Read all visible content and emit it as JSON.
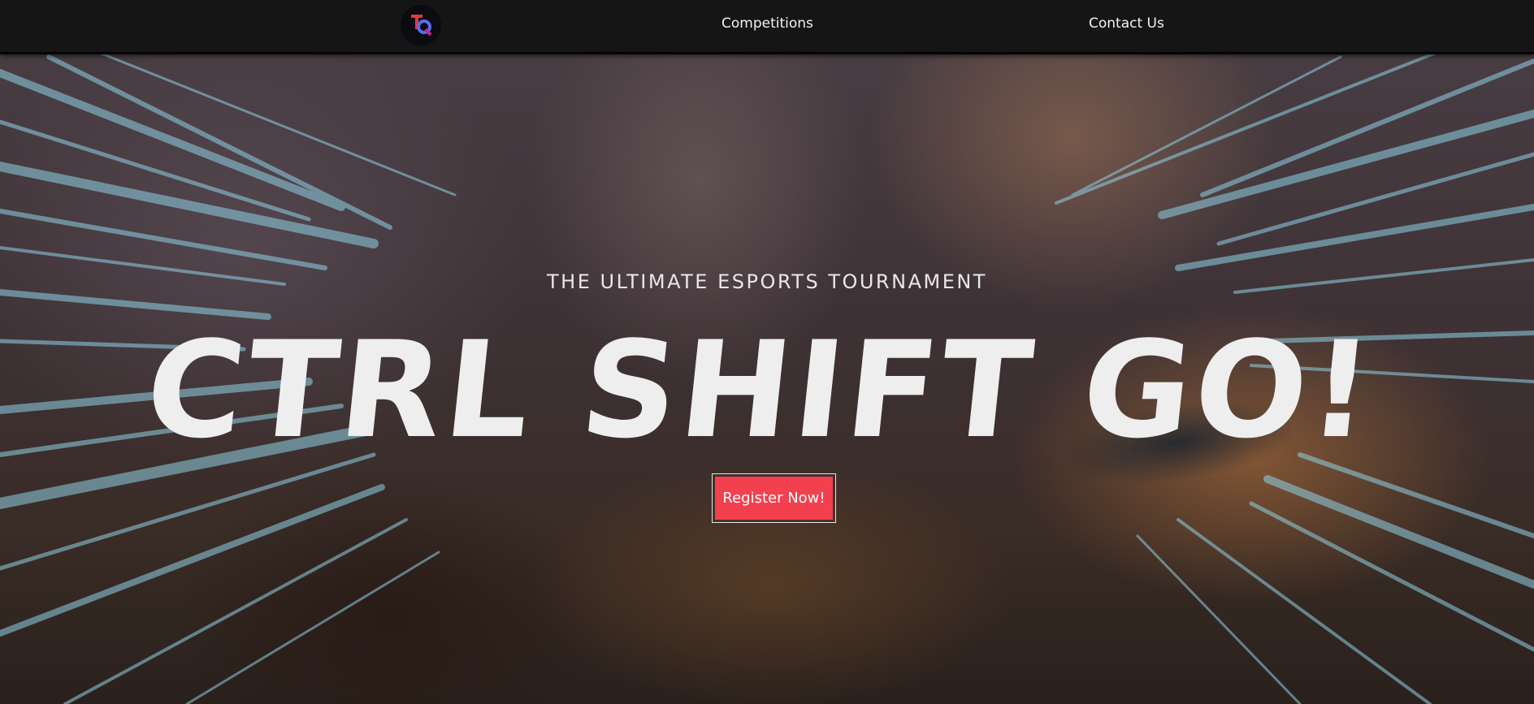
{
  "nav": {
    "logo_text": "TQ",
    "links": [
      {
        "label": "Competitions"
      },
      {
        "label": "Contact Us"
      }
    ]
  },
  "hero": {
    "tagline": "THE ULTIMATE ESPORTS TOURNAMENT",
    "title": "CTRL SHIFT GO!",
    "cta_label": "Register Now!"
  },
  "colors": {
    "navbar": "#151515",
    "title": "#eeeeee",
    "cta": "#f2404f",
    "speed_lines": "#8fd2e6"
  }
}
